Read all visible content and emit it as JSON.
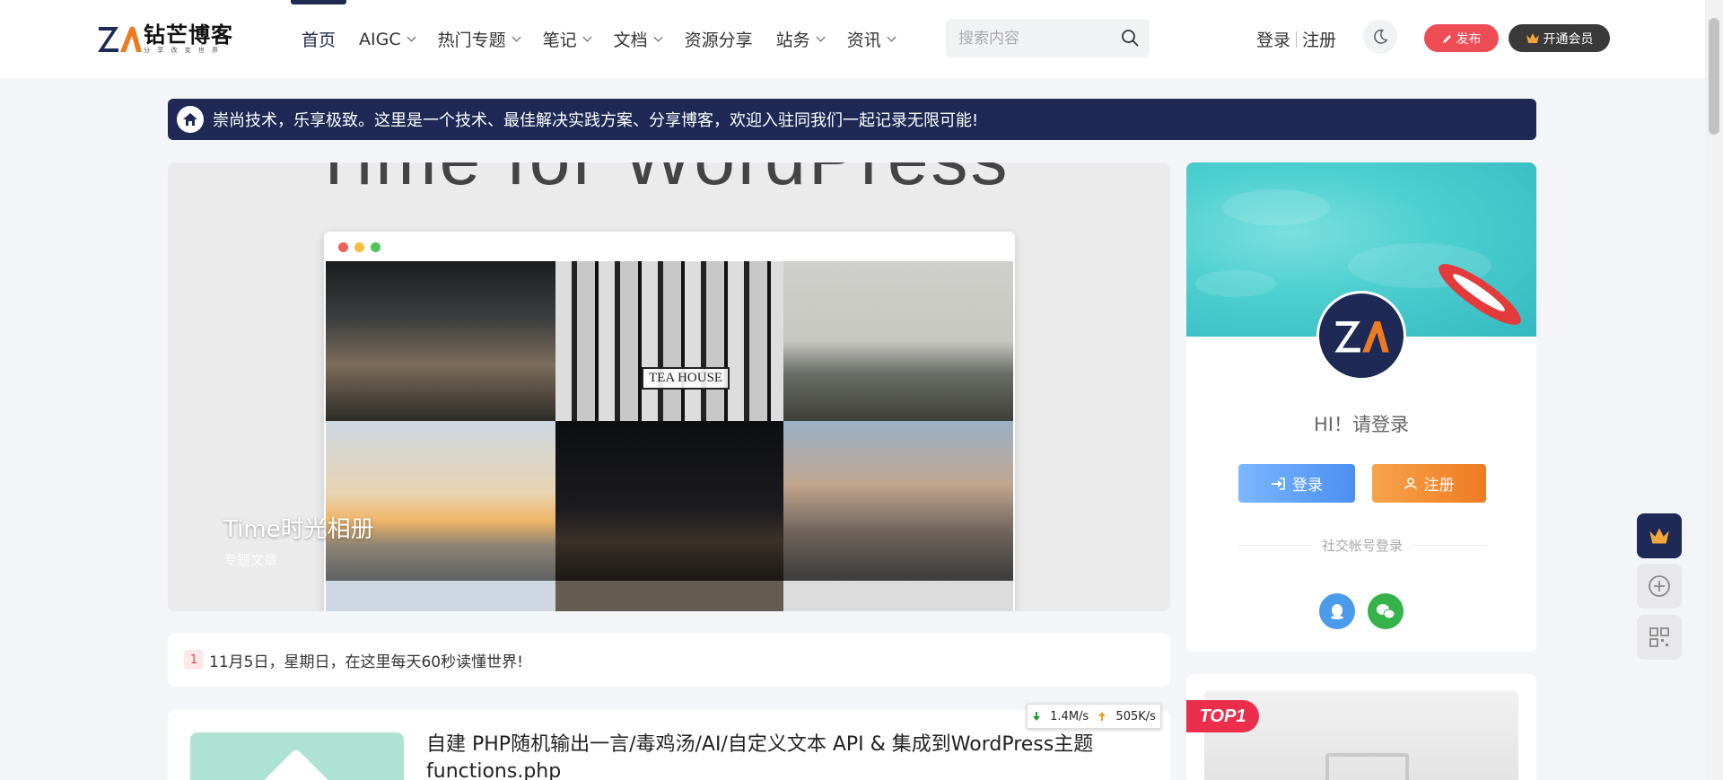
{
  "header": {
    "logo_name": "钻芒博客",
    "logo_sub": "分 享 改 变 世 界",
    "nav": [
      {
        "label": "首页",
        "dropdown": false,
        "active": true
      },
      {
        "label": "AIGC",
        "dropdown": true
      },
      {
        "label": "热门专题",
        "dropdown": true
      },
      {
        "label": "笔记",
        "dropdown": true
      },
      {
        "label": "文档",
        "dropdown": true
      },
      {
        "label": "资源分享",
        "dropdown": false
      },
      {
        "label": "站务",
        "dropdown": true
      },
      {
        "label": "资讯",
        "dropdown": true
      }
    ],
    "search_placeholder": "搜索内容",
    "login": "登录",
    "register": "注册",
    "publish": "发布",
    "vip": "开通会员"
  },
  "notice": {
    "text": "崇尚技术，乐享极致。这里是一个技术、最佳解决实践方案、分享博客，欢迎入驻同我们一起记录无限可能!"
  },
  "slider": {
    "bg_text": "Time for WordPress",
    "title": "Time时光相册",
    "category": "专题文章",
    "sign_text": "TEA HOUSE"
  },
  "newsbar": {
    "badge": "1",
    "text": "11月5日，星期日，在这里每天60秒读懂世界!"
  },
  "post": {
    "title": "自建 PHP随机输出一言/毒鸡汤/AI/自定义文本 API & 集成到WordPress主题 functions.php"
  },
  "speed": {
    "down": "1.4M/s",
    "up": "505K/s"
  },
  "usercard": {
    "greeting": "HI！请登录",
    "login_btn": "登录",
    "register_btn": "注册",
    "social_label": "社交帐号登录"
  },
  "topcard": {
    "badge": "TOP1"
  },
  "colors": {
    "brand_navy": "#1e2a55",
    "publish_red": "#ef4d55",
    "login_blue": "#4a8ff0",
    "register_orange": "#ee7b22"
  }
}
